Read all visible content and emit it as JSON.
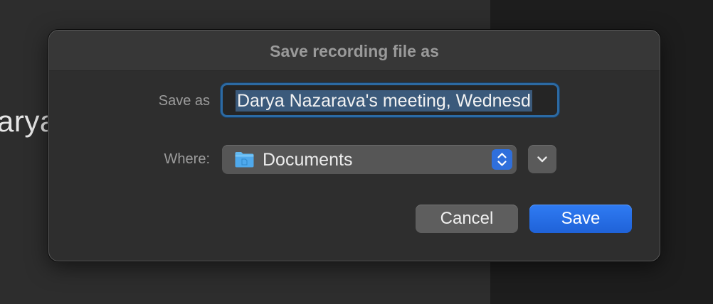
{
  "background": {
    "partial_text": "arya"
  },
  "dialog": {
    "title": "Save recording file as",
    "save_as_label": "Save as",
    "save_as_value": "Darya Nazarava's meeting, Wednesd",
    "where_label": "Where:",
    "where_value": "Documents",
    "where_icon": "folder-icon",
    "cancel_label": "Cancel",
    "save_label": "Save"
  },
  "colors": {
    "accent": "#2f6fdc",
    "focus_ring": "#2c6aa3",
    "selection": "#3b5a7b",
    "dialog_bg": "#2e2e2e"
  }
}
